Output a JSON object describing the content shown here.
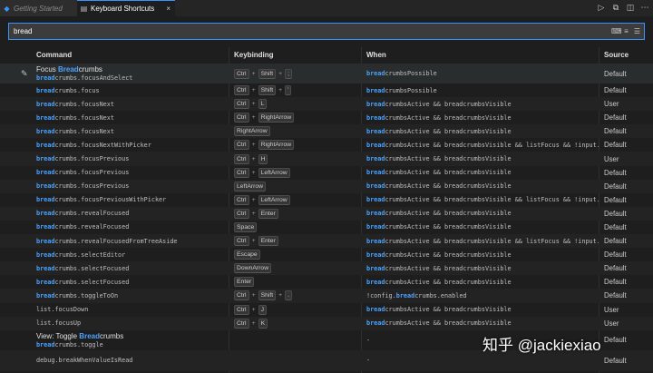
{
  "tabs": [
    {
      "label": "Getting Started",
      "icon": "vscode-logo-icon"
    },
    {
      "label": "Keyboard Shortcuts",
      "icon": "keyboard-icon",
      "close": "×"
    }
  ],
  "search": {
    "value": "bread"
  },
  "columns": {
    "command": "Command",
    "keybinding": "Keybinding",
    "when": "When",
    "source": "Source"
  },
  "rows": [
    {
      "title_pre": "Focus ",
      "title_hl": "Bread",
      "title_post": "crumbs",
      "cmd": "breadcrumbs.focusAndSelect",
      "keys": [
        "Ctrl",
        "Shift",
        ";"
      ],
      "when": "breadcrumbsPossible",
      "source": "Default"
    },
    {
      "cmd": "breadcrumbs.focus",
      "keys": [
        "Ctrl",
        "Shift",
        "'"
      ],
      "when": "breadcrumbsPossible",
      "source": "Default"
    },
    {
      "cmd": "breadcrumbs.focusNext",
      "keys": [
        "Ctrl",
        "L"
      ],
      "when": "breadcrumbsActive && breadcrumbsVisible",
      "source": "User"
    },
    {
      "cmd": "breadcrumbs.focusNext",
      "keys": [
        "Ctrl",
        "RightArrow"
      ],
      "when": "breadcrumbsActive && breadcrumbsVisible",
      "source": "Default"
    },
    {
      "cmd": "breadcrumbs.focusNext",
      "keys": [
        "RightArrow"
      ],
      "when": "breadcrumbsActive && breadcrumbsVisible",
      "source": "Default"
    },
    {
      "cmd": "breadcrumbs.focusNextWithPicker",
      "keys": [
        "Ctrl",
        "RightArrow"
      ],
      "when": "breadcrumbsActive && breadcrumbsVisible && listFocus && !input...",
      "source": "Default"
    },
    {
      "cmd": "breadcrumbs.focusPrevious",
      "keys": [
        "Ctrl",
        "H"
      ],
      "when": "breadcrumbsActive && breadcrumbsVisible",
      "source": "User"
    },
    {
      "cmd": "breadcrumbs.focusPrevious",
      "keys": [
        "Ctrl",
        "LeftArrow"
      ],
      "when": "breadcrumbsActive && breadcrumbsVisible",
      "source": "Default"
    },
    {
      "cmd": "breadcrumbs.focusPrevious",
      "keys": [
        "LeftArrow"
      ],
      "when": "breadcrumbsActive && breadcrumbsVisible",
      "source": "Default"
    },
    {
      "cmd": "breadcrumbs.focusPreviousWithPicker",
      "keys": [
        "Ctrl",
        "LeftArrow"
      ],
      "when": "breadcrumbsActive && breadcrumbsVisible && listFocus && !input...",
      "source": "Default"
    },
    {
      "cmd": "breadcrumbs.revealFocused",
      "keys": [
        "Ctrl",
        "Enter"
      ],
      "when": "breadcrumbsActive && breadcrumbsVisible",
      "source": "Default"
    },
    {
      "cmd": "breadcrumbs.revealFocused",
      "keys": [
        "Space"
      ],
      "when": "breadcrumbsActive && breadcrumbsVisible",
      "source": "Default"
    },
    {
      "cmd": "breadcrumbs.revealFocusedFromTreeAside",
      "keys": [
        "Ctrl",
        "Enter"
      ],
      "when": "breadcrumbsActive && breadcrumbsVisible && listFocus && !input...",
      "source": "Default"
    },
    {
      "cmd": "breadcrumbs.selectEditor",
      "keys": [
        "Escape"
      ],
      "when": "breadcrumbsActive && breadcrumbsVisible",
      "source": "Default"
    },
    {
      "cmd": "breadcrumbs.selectFocused",
      "keys": [
        "DownArrow"
      ],
      "when": "breadcrumbsActive && breadcrumbsVisible",
      "source": "Default"
    },
    {
      "cmd": "breadcrumbs.selectFocused",
      "keys": [
        "Enter"
      ],
      "when": "breadcrumbsActive && breadcrumbsVisible",
      "source": "Default"
    },
    {
      "cmd": "breadcrumbs.toggleToOn",
      "keys": [
        "Ctrl",
        "Shift",
        "."
      ],
      "when": "!config.breadcrumbs.enabled",
      "source": "Default"
    },
    {
      "cmd": "list.focusDown",
      "keys": [
        "Ctrl",
        "J"
      ],
      "when": "breadcrumbsActive && breadcrumbsVisible",
      "source": "User"
    },
    {
      "cmd": "list.focusUp",
      "keys": [
        "Ctrl",
        "K"
      ],
      "when": "breadcrumbsActive && breadcrumbsVisible",
      "source": "User"
    },
    {
      "title_pre": "View: Toggle ",
      "title_hl": "Bread",
      "title_post": "crumbs",
      "cmd": "breadcrumbs.toggle",
      "keys": [],
      "when": "-",
      "source": "Default"
    },
    {
      "cmd": "debug.breakWhenValueIsRead",
      "keys": [],
      "when": "-",
      "source": "Default"
    }
  ],
  "watermark": "知乎 @jackiexiao"
}
